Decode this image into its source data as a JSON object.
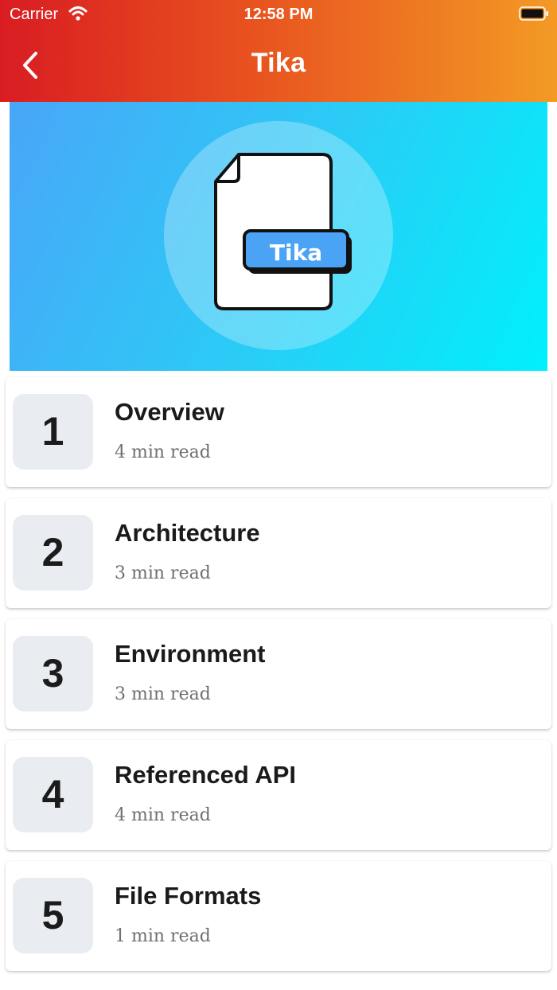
{
  "status_bar": {
    "carrier": "Carrier",
    "time": "12:58 PM"
  },
  "header": {
    "title": "Tika",
    "back_icon": "chevron-left-icon"
  },
  "hero": {
    "badge_text": "Tika",
    "icon": "document-icon"
  },
  "colors": {
    "header_start": "#d91c22",
    "header_end": "#f39a25",
    "hero_start": "#49a6f8",
    "hero_end": "#00f0fc",
    "badge": "#4aa3f5"
  },
  "chapters": [
    {
      "number": "1",
      "title": "Overview",
      "read_time": "4 min read"
    },
    {
      "number": "2",
      "title": "Architecture",
      "read_time": "3 min read"
    },
    {
      "number": "3",
      "title": "Environment",
      "read_time": "3 min read"
    },
    {
      "number": "4",
      "title": "Referenced API",
      "read_time": "4 min read"
    },
    {
      "number": "5",
      "title": "File Formats",
      "read_time": "1 min read"
    }
  ]
}
